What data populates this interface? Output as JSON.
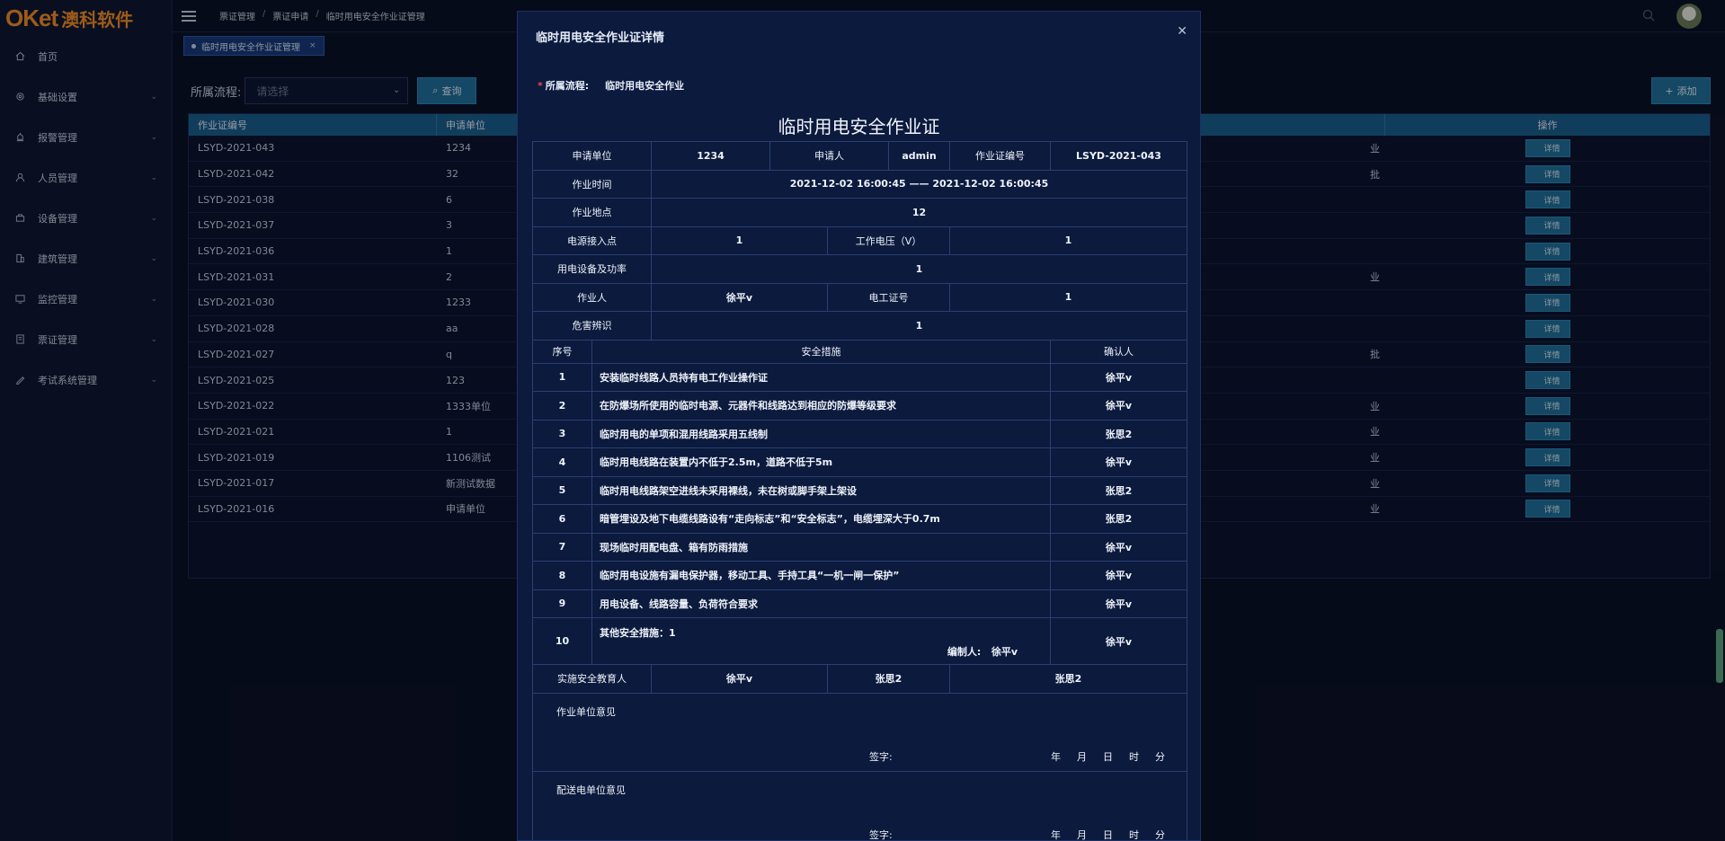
{
  "brand": {
    "latin": "OKet",
    "cn": "澳科软件"
  },
  "sidebar": {
    "items": [
      {
        "label": "首页",
        "icon": "home-icon",
        "chevron": false
      },
      {
        "label": "基础设置",
        "icon": "gear-icon",
        "chevron": true
      },
      {
        "label": "报警管理",
        "icon": "alarm-icon",
        "chevron": true
      },
      {
        "label": "人员管理",
        "icon": "user-icon",
        "chevron": true
      },
      {
        "label": "设备管理",
        "icon": "device-icon",
        "chevron": true
      },
      {
        "label": "建筑管理",
        "icon": "building-icon",
        "chevron": true
      },
      {
        "label": "监控管理",
        "icon": "monitor-icon",
        "chevron": true
      },
      {
        "label": "票证管理",
        "icon": "ticket-icon",
        "chevron": true
      },
      {
        "label": "考试系统管理",
        "icon": "exam-icon",
        "chevron": true
      }
    ]
  },
  "breadcrumb": [
    "票证管理",
    "票证申请",
    "临时用电安全作业证管理"
  ],
  "tab": {
    "label": "临时用电安全作业证管理"
  },
  "filter": {
    "label": "所属流程:",
    "placeholder": "请选择",
    "query": "查询",
    "add": "添加"
  },
  "table": {
    "headers": [
      "作业证编号",
      "申请单位",
      "",
      "操作"
    ],
    "action_label": "详情",
    "rows": [
      {
        "id": "LSYD-2021-043",
        "unit": "1234",
        "tail": "业"
      },
      {
        "id": "LSYD-2021-042",
        "unit": "32",
        "tail": "批"
      },
      {
        "id": "LSYD-2021-038",
        "unit": "6",
        "tail": ""
      },
      {
        "id": "LSYD-2021-037",
        "unit": "3",
        "tail": ""
      },
      {
        "id": "LSYD-2021-036",
        "unit": "1",
        "tail": ""
      },
      {
        "id": "LSYD-2021-031",
        "unit": "2",
        "tail": "业"
      },
      {
        "id": "LSYD-2021-030",
        "unit": "1233",
        "tail": ""
      },
      {
        "id": "LSYD-2021-028",
        "unit": "aa",
        "tail": ""
      },
      {
        "id": "LSYD-2021-027",
        "unit": "q",
        "tail": "批"
      },
      {
        "id": "LSYD-2021-025",
        "unit": "123",
        "tail": ""
      },
      {
        "id": "LSYD-2021-022",
        "unit": "1333单位",
        "tail": "业"
      },
      {
        "id": "LSYD-2021-021",
        "unit": "1",
        "tail": "业"
      },
      {
        "id": "LSYD-2021-019",
        "unit": "1106测试",
        "tail": "业"
      },
      {
        "id": "LSYD-2021-017",
        "unit": "新测试数据",
        "tail": "业"
      },
      {
        "id": "LSYD-2021-016",
        "unit": "申请单位",
        "tail": "业"
      }
    ]
  },
  "dialog": {
    "title": "临时用电安全作业证详情",
    "process_label": "所属流程:",
    "process_value": "临时用电安全作业",
    "form_title": "临时用电安全作业证",
    "labels": {
      "apply_unit": "申请单位",
      "applicant": "申请人",
      "cert_no": "作业证编号",
      "work_time": "作业时间",
      "work_place": "作业地点",
      "power_point": "电源接入点",
      "voltage": "工作电压（V）",
      "equipment": "用电设备及功率",
      "worker": "作业人",
      "electrician_cert": "电工证号",
      "hazard": "危害辨识",
      "seq": "序号",
      "measures": "安全措施",
      "confirmer": "确认人",
      "educator": "实施安全教育人",
      "editor": "编制人:",
      "unit_opinion": "作业单位意见",
      "power_opinion": "配送电单位意见",
      "sign": "签字:",
      "year": "年",
      "month": "月",
      "day": "日",
      "hour": "时",
      "minute": "分"
    },
    "values": {
      "apply_unit": "1234",
      "applicant": "admin",
      "cert_no": "LSYD-2021-043",
      "work_time": "2021-12-02 16:00:45 —— 2021-12-02 16:00:45",
      "work_place": "12",
      "power_point": "1",
      "voltage": "1",
      "equipment": "1",
      "worker": "徐平v",
      "electrician_cert": "1",
      "hazard": "1",
      "editor": "徐平v",
      "educators": [
        "徐平v",
        "张思2",
        "张思2"
      ]
    },
    "measures": [
      {
        "no": "1",
        "text": "安装临时线路人员持有电工作业操作证",
        "by": "徐平v"
      },
      {
        "no": "2",
        "text": "在防爆场所使用的临时电源、元器件和线路达到相应的防爆等级要求",
        "by": "徐平v"
      },
      {
        "no": "3",
        "text": "临时用电的单项和混用线路采用五线制",
        "by": "张思2"
      },
      {
        "no": "4",
        "text": "临时用电线路在装置内不低于2.5m，道路不低于5m",
        "by": "徐平v"
      },
      {
        "no": "5",
        "text": "临时用电线路架空进线未采用裸线，未在树或脚手架上架设",
        "by": "张思2"
      },
      {
        "no": "6",
        "text": "暗管埋设及地下电缆线路设有“走向标志”和“安全标志”，电缆埋深大于0.7m",
        "by": "张思2"
      },
      {
        "no": "7",
        "text": "现场临时用配电盘、箱有防雨措施",
        "by": "徐平v"
      },
      {
        "no": "8",
        "text": "临时用电设施有漏电保护器，移动工具、手持工具“一机一闸一保护”",
        "by": "徐平v"
      },
      {
        "no": "9",
        "text": "用电设备、线路容量、负荷符合要求",
        "by": "徐平v"
      }
    ],
    "other": {
      "no": "10",
      "text": "其他安全措施：1",
      "by": "徐平v"
    }
  }
}
